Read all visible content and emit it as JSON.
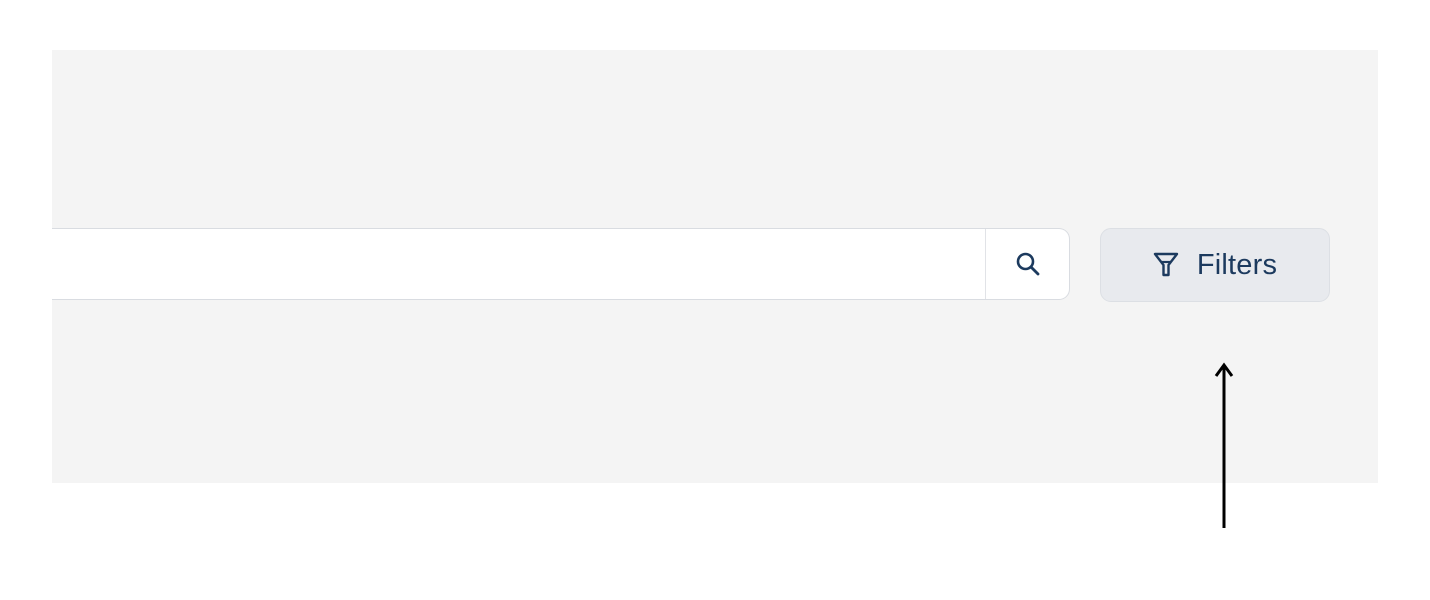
{
  "search": {
    "value": "",
    "placeholder": "",
    "icon": "search-icon"
  },
  "filters": {
    "label": "Filters",
    "icon": "filter-funnel-icon"
  },
  "annotation": {
    "icon": "arrow-up-icon"
  },
  "colors": {
    "panel_background": "#f4f4f4",
    "button_background": "#e8eaee",
    "text_primary": "#1c3a5e",
    "annotation_arrow": "#000000"
  }
}
